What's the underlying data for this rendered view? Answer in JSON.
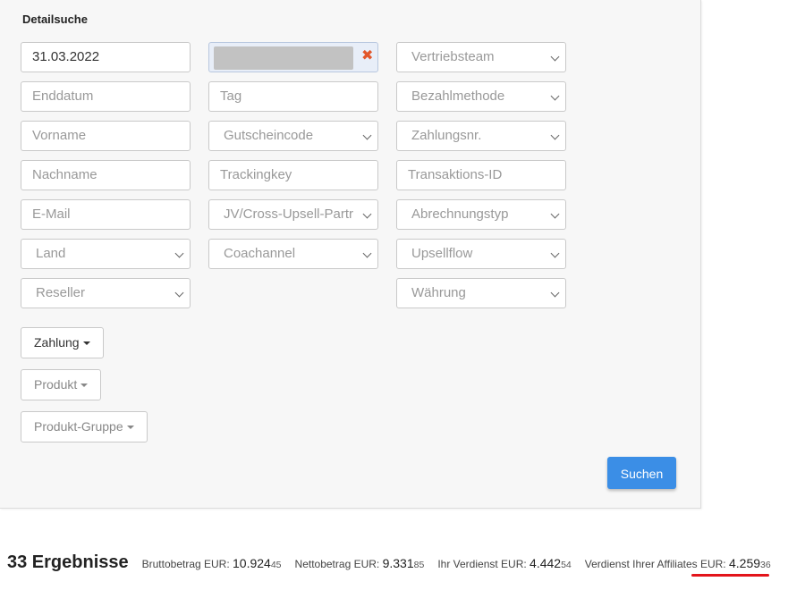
{
  "panel": {
    "title": "Detailsuche",
    "col1": [
      {
        "kind": "input",
        "value": "31.03.2022",
        "placeholder": ""
      },
      {
        "kind": "input",
        "value": "",
        "placeholder": "Enddatum"
      },
      {
        "kind": "input",
        "value": "",
        "placeholder": "Vorname"
      },
      {
        "kind": "input",
        "value": "",
        "placeholder": "Nachname"
      },
      {
        "kind": "input",
        "value": "",
        "placeholder": "E-Mail"
      },
      {
        "kind": "select",
        "label": "Land"
      },
      {
        "kind": "select",
        "label": "Reseller"
      }
    ],
    "col2": [
      {
        "kind": "tag",
        "remove_glyph": "✖"
      },
      {
        "kind": "input",
        "value": "",
        "placeholder": "Tag"
      },
      {
        "kind": "select",
        "label": "Gutscheincode"
      },
      {
        "kind": "input",
        "value": "",
        "placeholder": "Trackingkey"
      },
      {
        "kind": "select",
        "label": "JV/Cross-Upsell-Partr"
      },
      {
        "kind": "select",
        "label": "Coachannel"
      }
    ],
    "col3": [
      {
        "kind": "select",
        "label": "Vertriebsteam"
      },
      {
        "kind": "select",
        "label": "Bezahlmethode"
      },
      {
        "kind": "select",
        "label": "Zahlungsnr."
      },
      {
        "kind": "input",
        "value": "",
        "placeholder": "Transaktions-ID"
      },
      {
        "kind": "select",
        "label": "Abrechnungstyp"
      },
      {
        "kind": "select",
        "label": "Upsellflow"
      },
      {
        "kind": "select",
        "label": "Währung"
      }
    ],
    "dropdowns": [
      "Zahlung",
      "Produkt",
      "Produkt-Gruppe"
    ],
    "search_label": "Suchen"
  },
  "results": {
    "count_label": "33 Ergebnisse",
    "stats": [
      {
        "label": "Bruttobetrag EUR:",
        "major": "10.924",
        "minor": "45"
      },
      {
        "label": "Nettobetrag EUR:",
        "major": "9.331",
        "minor": "85"
      },
      {
        "label": "Ihr Verdienst EUR:",
        "major": "4.442",
        "minor": "54"
      },
      {
        "label": "Verdienst Ihrer Affiliates EUR:",
        "major": "4.259",
        "minor": "36"
      }
    ]
  },
  "colors": {
    "primary_button": "#3b8ee6",
    "highlight_underline": "#e3141b",
    "tag_remove": "#e2572b"
  }
}
